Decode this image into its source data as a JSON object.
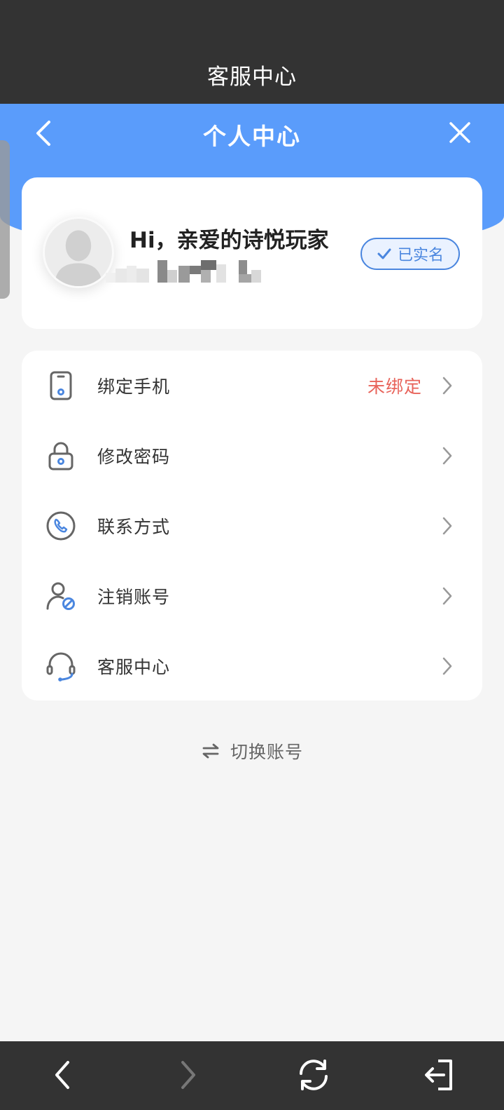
{
  "topbar": {
    "title": "客服中心"
  },
  "header": {
    "title": "个人中心",
    "back_icon": "chevron-left-icon",
    "close_icon": "close-icon"
  },
  "profile": {
    "greeting": "Hi，亲爱的诗悦玩家",
    "verified_label": "已实名"
  },
  "menu": {
    "items": [
      {
        "label": "绑定手机",
        "status": "未绑定",
        "icon": "phone-icon"
      },
      {
        "label": "修改密码",
        "status": "",
        "icon": "lock-icon"
      },
      {
        "label": "联系方式",
        "status": "",
        "icon": "phone-call-icon"
      },
      {
        "label": "注销账号",
        "status": "",
        "icon": "user-cancel-icon"
      },
      {
        "label": "客服中心",
        "status": "",
        "icon": "headset-icon"
      }
    ]
  },
  "switch_account": {
    "label": "切换账号"
  },
  "colors": {
    "brand_blue": "#5a9cfb",
    "alert_red": "#e8635a",
    "dark_bar": "#333333"
  }
}
